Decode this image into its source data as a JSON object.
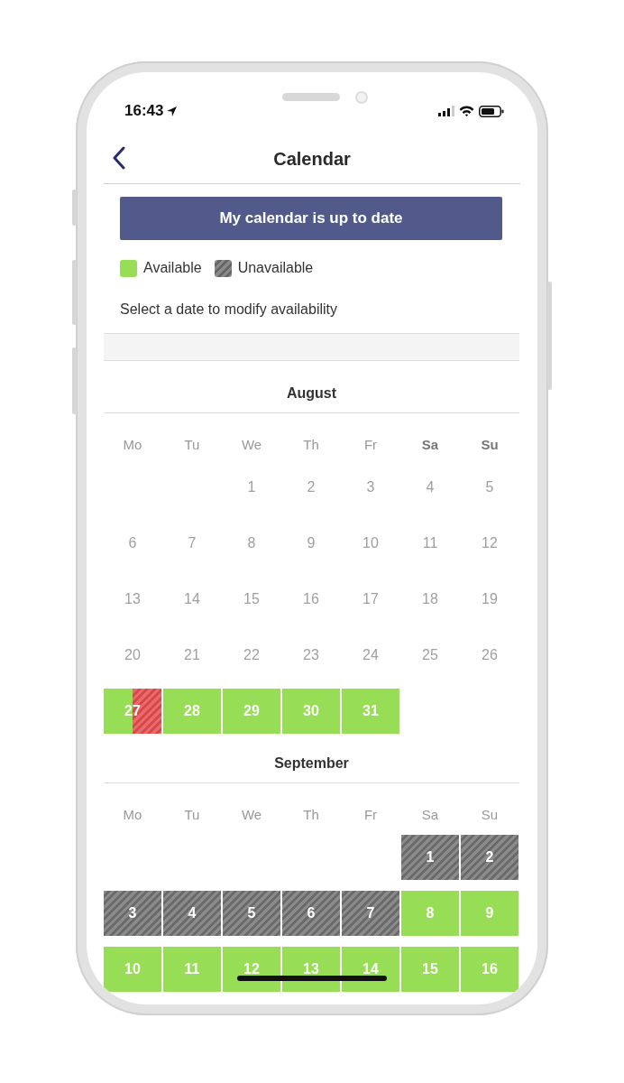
{
  "status_bar": {
    "time": "16:43"
  },
  "nav": {
    "title": "Calendar"
  },
  "update_button": {
    "label": "My calendar is up to date"
  },
  "legend": [
    {
      "label": "Available",
      "kind": "available"
    },
    {
      "label": "Unavailable",
      "kind": "unavailable"
    }
  ],
  "instruction": "Select a date to modify availability",
  "months": [
    {
      "title": "August",
      "weekdays": [
        {
          "label": "Mo",
          "bold": false
        },
        {
          "label": "Tu",
          "bold": false
        },
        {
          "label": "We",
          "bold": false
        },
        {
          "label": "Th",
          "bold": false
        },
        {
          "label": "Fr",
          "bold": false
        },
        {
          "label": "Sa",
          "bold": true
        },
        {
          "label": "Su",
          "bold": true
        }
      ],
      "weeks": [
        [
          {
            "kind": "blank"
          },
          {
            "kind": "blank"
          },
          {
            "day": "1",
            "kind": "past"
          },
          {
            "day": "2",
            "kind": "past"
          },
          {
            "day": "3",
            "kind": "past"
          },
          {
            "day": "4",
            "kind": "past"
          },
          {
            "day": "5",
            "kind": "past"
          }
        ],
        [
          {
            "day": "6",
            "kind": "past"
          },
          {
            "day": "7",
            "kind": "past"
          },
          {
            "day": "8",
            "kind": "past"
          },
          {
            "day": "9",
            "kind": "past"
          },
          {
            "day": "10",
            "kind": "past"
          },
          {
            "day": "11",
            "kind": "past"
          },
          {
            "day": "12",
            "kind": "past"
          }
        ],
        [
          {
            "day": "13",
            "kind": "past"
          },
          {
            "day": "14",
            "kind": "past"
          },
          {
            "day": "15",
            "kind": "past"
          },
          {
            "day": "16",
            "kind": "past"
          },
          {
            "day": "17",
            "kind": "past"
          },
          {
            "day": "18",
            "kind": "past"
          },
          {
            "day": "19",
            "kind": "past"
          }
        ],
        [
          {
            "day": "20",
            "kind": "past"
          },
          {
            "day": "21",
            "kind": "past"
          },
          {
            "day": "22",
            "kind": "past"
          },
          {
            "day": "23",
            "kind": "past"
          },
          {
            "day": "24",
            "kind": "past"
          },
          {
            "day": "25",
            "kind": "past"
          },
          {
            "day": "26",
            "kind": "past"
          }
        ],
        [
          {
            "day": "27",
            "kind": "partial"
          },
          {
            "day": "28",
            "kind": "available"
          },
          {
            "day": "29",
            "kind": "available"
          },
          {
            "day": "30",
            "kind": "available"
          },
          {
            "day": "31",
            "kind": "available"
          },
          {
            "kind": "blank"
          },
          {
            "kind": "blank"
          }
        ]
      ]
    },
    {
      "title": "September",
      "weekdays": [
        {
          "label": "Mo",
          "bold": false
        },
        {
          "label": "Tu",
          "bold": false
        },
        {
          "label": "We",
          "bold": false
        },
        {
          "label": "Th",
          "bold": false
        },
        {
          "label": "Fr",
          "bold": false
        },
        {
          "label": "Sa",
          "bold": false
        },
        {
          "label": "Su",
          "bold": false
        }
      ],
      "weeks": [
        [
          {
            "kind": "blank"
          },
          {
            "kind": "blank"
          },
          {
            "kind": "blank"
          },
          {
            "kind": "blank"
          },
          {
            "kind": "blank"
          },
          {
            "day": "1",
            "kind": "unavailable"
          },
          {
            "day": "2",
            "kind": "unavailable"
          }
        ],
        [
          {
            "day": "3",
            "kind": "unavailable"
          },
          {
            "day": "4",
            "kind": "unavailable"
          },
          {
            "day": "5",
            "kind": "unavailable"
          },
          {
            "day": "6",
            "kind": "unavailable"
          },
          {
            "day": "7",
            "kind": "unavailable"
          },
          {
            "day": "8",
            "kind": "available"
          },
          {
            "day": "9",
            "kind": "available"
          }
        ],
        [
          {
            "day": "10",
            "kind": "available"
          },
          {
            "day": "11",
            "kind": "available"
          },
          {
            "day": "12",
            "kind": "available"
          },
          {
            "day": "13",
            "kind": "available"
          },
          {
            "day": "14",
            "kind": "available"
          },
          {
            "day": "15",
            "kind": "available"
          },
          {
            "day": "16",
            "kind": "available"
          }
        ]
      ]
    }
  ]
}
